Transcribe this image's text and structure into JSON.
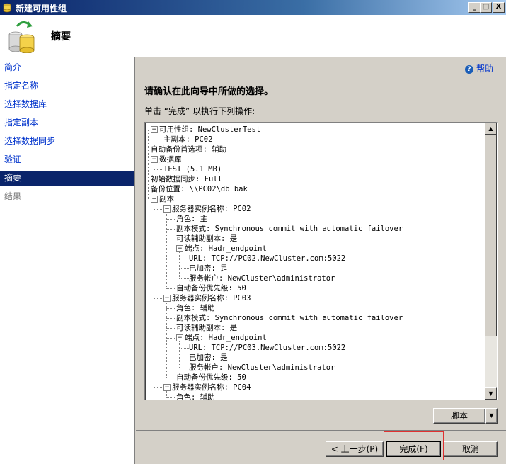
{
  "window": {
    "title": "新建可用性组",
    "minimize": "_",
    "maximize": "□",
    "close": "X"
  },
  "header": {
    "title": "摘要"
  },
  "nav": {
    "items": [
      {
        "label": "简介",
        "state": "link"
      },
      {
        "label": "指定名称",
        "state": "link"
      },
      {
        "label": "选择数据库",
        "state": "link"
      },
      {
        "label": "指定副本",
        "state": "link"
      },
      {
        "label": "选择数据同步",
        "state": "link"
      },
      {
        "label": "验证",
        "state": "link"
      },
      {
        "label": "摘要",
        "state": "active"
      },
      {
        "label": "结果",
        "state": "disabled"
      }
    ]
  },
  "help": {
    "label": "帮助"
  },
  "main": {
    "heading": "请确认在此向导中所做的选择。",
    "instruction": "单击 “完成” 以执行下列操作:"
  },
  "tree": [
    {
      "level": 0,
      "expander": "−",
      "text": "可用性组: NewClusterTest"
    },
    {
      "level": 1,
      "expander": "",
      "text": "主副本: PC02"
    },
    {
      "level": 0,
      "expander": "",
      "text": "自动备份首选项: 辅助"
    },
    {
      "level": 0,
      "expander": "−",
      "text": "数据库"
    },
    {
      "level": 1,
      "expander": "",
      "text": "TEST (5.1 MB)"
    },
    {
      "level": 0,
      "expander": "",
      "text": "初始数据同步: Full"
    },
    {
      "level": 0,
      "expander": "",
      "text": "备份位置: \\\\PC02\\db_bak"
    },
    {
      "level": 0,
      "expander": "−",
      "text": "副本"
    },
    {
      "level": 1,
      "expander": "−",
      "text": "服务器实例名称: PC02"
    },
    {
      "level": 2,
      "expander": "",
      "text": "角色: 主"
    },
    {
      "level": 2,
      "expander": "",
      "text": "副本模式: Synchronous commit with automatic failover"
    },
    {
      "level": 2,
      "expander": "",
      "text": "可读辅助副本: 是"
    },
    {
      "level": 2,
      "expander": "−",
      "text": "端点: Hadr_endpoint"
    },
    {
      "level": 3,
      "expander": "",
      "text": "URL: TCP://PC02.NewCluster.com:5022"
    },
    {
      "level": 3,
      "expander": "",
      "text": "已加密: 是"
    },
    {
      "level": 3,
      "expander": "",
      "text": "服务帐户: NewCluster\\administrator"
    },
    {
      "level": 2,
      "expander": "",
      "text": "自动备份优先级: 50"
    },
    {
      "level": 1,
      "expander": "−",
      "text": "服务器实例名称: PC03"
    },
    {
      "level": 2,
      "expander": "",
      "text": "角色: 辅助"
    },
    {
      "level": 2,
      "expander": "",
      "text": "副本模式: Synchronous commit with automatic failover"
    },
    {
      "level": 2,
      "expander": "",
      "text": "可读辅助副本: 是"
    },
    {
      "level": 2,
      "expander": "−",
      "text": "端点: Hadr_endpoint"
    },
    {
      "level": 3,
      "expander": "",
      "text": "URL: TCP://PC03.NewCluster.com:5022"
    },
    {
      "level": 3,
      "expander": "",
      "text": "已加密: 是"
    },
    {
      "level": 3,
      "expander": "",
      "text": "服务帐户: NewCluster\\administrator"
    },
    {
      "level": 2,
      "expander": "",
      "text": "自动备份优先级: 50"
    },
    {
      "level": 1,
      "expander": "−",
      "text": "服务器实例名称: PC04"
    },
    {
      "level": 2,
      "expander": "",
      "text": "角色: 辅助"
    }
  ],
  "buttons": {
    "script": "脚本",
    "script_arrow": "▼",
    "prev": "< 上一步(P)",
    "finish": "完成(F)",
    "cancel": "取消"
  },
  "colors": {
    "link": "#0033cc",
    "nav_active_bg": "#0a246a",
    "highlight_box": "#e03030"
  }
}
